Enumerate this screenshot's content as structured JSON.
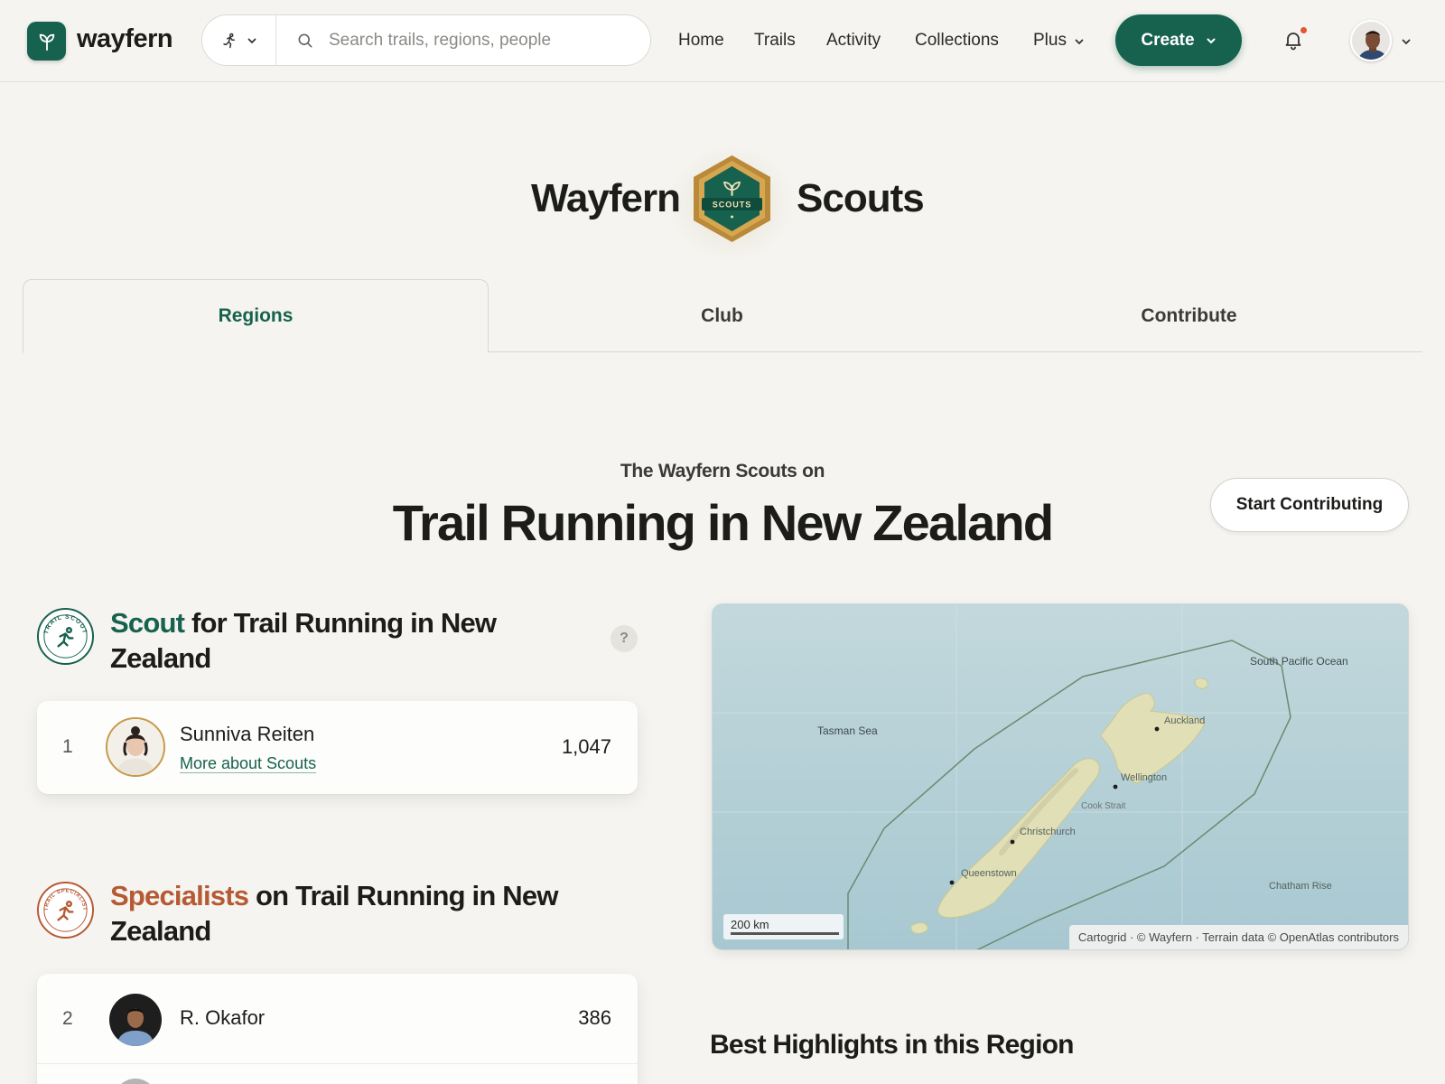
{
  "brand": {
    "name": "wayfern"
  },
  "search": {
    "placeholder": "Search trails, regions, people"
  },
  "nav": {
    "links": [
      "Home",
      "Trails",
      "Activity",
      "Collections",
      "Plus"
    ],
    "create_label": "Create"
  },
  "hero": {
    "left_word": "Wayfern",
    "right_word": "Scouts",
    "badge_text": "SCOUTS"
  },
  "tabs": [
    {
      "label": "Regions",
      "active": true
    },
    {
      "label": "Club",
      "active": false
    },
    {
      "label": "Contribute",
      "active": false
    }
  ],
  "section": {
    "kicker": "The Wayfern Scouts on",
    "title": "Trail Running in New Zealand",
    "start_button": "Start Contributing"
  },
  "scout_block": {
    "accent": "Scout",
    "rest": " for Trail Running in New Zealand",
    "help": "?",
    "emblem_text": "TRAIL SCOUT",
    "entries": [
      {
        "rank": "1",
        "name": "Sunniva Reiten",
        "link": "More about Scouts",
        "score": "1,047"
      }
    ]
  },
  "specialist_block": {
    "accent": "Specialists",
    "rest": " on Trail Running in New Zealand",
    "emblem_text": "TRAIL SPECIALIST",
    "entries": [
      {
        "rank": "2",
        "name": "R. Okafor",
        "score": "386"
      }
    ]
  },
  "map": {
    "labels": {
      "south_pacific": "South Pacific Ocean",
      "tasman": "Tasman Sea",
      "auckland": "Auckland",
      "wellington": "Wellington",
      "cook_strait": "Cook Strait",
      "christchurch": "Christchurch",
      "queenstown": "Queenstown",
      "chatham": "Chatham Rise"
    },
    "scale": "200 km",
    "attribution": "Cartogrid · © Wayfern · Terrain data © OpenAtlas contributors"
  },
  "highlights_title": "Best Highlights in this Region",
  "colors": {
    "brand_green": "#17624e",
    "accent_rust": "#b65a34",
    "background": "#f5f4f0"
  }
}
